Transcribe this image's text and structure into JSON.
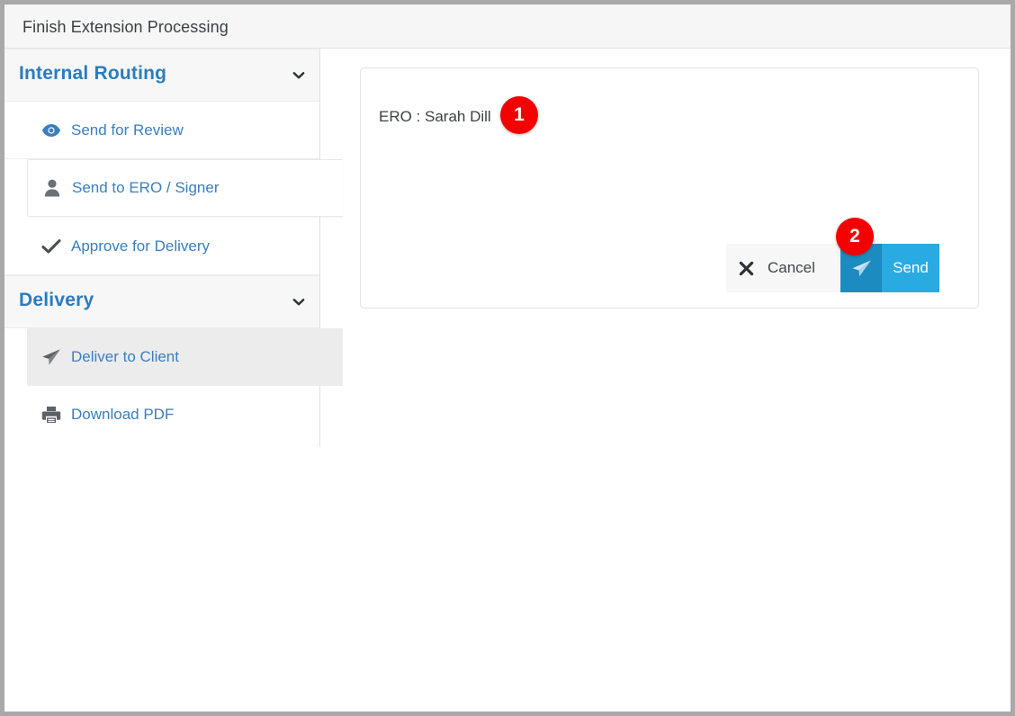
{
  "window": {
    "title": "Finish Extension Processing"
  },
  "sidebar": {
    "sections": [
      {
        "key": "internal-routing",
        "title": "Internal Routing",
        "collapse_icon": "chevron-down-icon",
        "items": [
          {
            "key": "send-review",
            "label": "Send for Review",
            "icon": "eye-icon",
            "state": "default"
          },
          {
            "key": "send-ero",
            "label": "Send to ERO / Signer",
            "icon": "user-icon",
            "state": "active"
          },
          {
            "key": "approve-delivery",
            "label": "Approve for Delivery",
            "icon": "check-icon",
            "state": "default"
          }
        ]
      },
      {
        "key": "delivery",
        "title": "Delivery",
        "collapse_icon": "chevron-down-icon",
        "items": [
          {
            "key": "deliver-client",
            "label": "Deliver to Client",
            "icon": "paper-plane-icon",
            "state": "highlight"
          },
          {
            "key": "download-pdf",
            "label": "Download PDF",
            "icon": "printer-icon",
            "state": "default"
          }
        ]
      }
    ]
  },
  "main": {
    "ero_line": "ERO : Sarah Dill",
    "buttons": {
      "cancel": {
        "label": "Cancel",
        "icon": "close-x-icon"
      },
      "send": {
        "label": "Send",
        "icon": "paper-plane-icon"
      }
    }
  },
  "annotations": {
    "badges": [
      {
        "number": "1",
        "target": "ero-line"
      },
      {
        "number": "2",
        "target": "send-button"
      }
    ]
  },
  "colors": {
    "accent_blue": "#3a7ebf",
    "heading_blue": "#2b7cc0",
    "send_button": "#29abe2",
    "send_button_icon": "#1c8bbf",
    "badge_red": "#f40000",
    "header_bg": "#f6f6f6",
    "frame_border": "#a9a9a9"
  }
}
